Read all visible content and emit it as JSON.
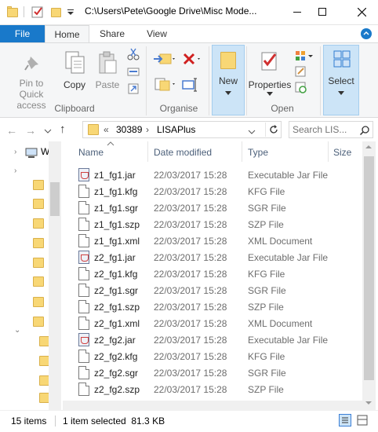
{
  "window": {
    "title": "C:\\Users\\Pete\\Google Drive\\Misc Mode...",
    "controls": [
      "minimize",
      "maximize",
      "close"
    ]
  },
  "ribbon": {
    "tabs": [
      "File",
      "Home",
      "Share",
      "View"
    ],
    "clipboard": {
      "pin": "Pin to Quick access",
      "copy": "Copy",
      "paste": "Paste",
      "label": "Clipboard"
    },
    "organise": {
      "label": "Organise"
    },
    "new": {
      "new_label": "New"
    },
    "open": {
      "properties": "Properties",
      "label": "Open"
    },
    "select": {
      "select_label": "Select"
    }
  },
  "address": {
    "overflow": "«",
    "crumbs": [
      "30389",
      "LISAPlus"
    ],
    "search_placeholder": "Search LIS..."
  },
  "nav": {
    "item_label": "W"
  },
  "columns": [
    "Name",
    "Date modified",
    "Type",
    "Size"
  ],
  "files": [
    {
      "name": "z1_fg1.jar",
      "date": "22/03/2017 15:28",
      "type": "Executable Jar File",
      "icon": "jar"
    },
    {
      "name": "z1_fg1.kfg",
      "date": "22/03/2017 15:28",
      "type": "KFG File",
      "icon": "doc"
    },
    {
      "name": "z1_fg1.sgr",
      "date": "22/03/2017 15:28",
      "type": "SGR File",
      "icon": "doc"
    },
    {
      "name": "z1_fg1.szp",
      "date": "22/03/2017 15:28",
      "type": "SZP File",
      "icon": "doc"
    },
    {
      "name": "z1_fg1.xml",
      "date": "22/03/2017 15:28",
      "type": "XML Document",
      "icon": "doc"
    },
    {
      "name": "z2_fg1.jar",
      "date": "22/03/2017 15:28",
      "type": "Executable Jar File",
      "icon": "jar"
    },
    {
      "name": "z2_fg1.kfg",
      "date": "22/03/2017 15:28",
      "type": "KFG File",
      "icon": "doc"
    },
    {
      "name": "z2_fg1.sgr",
      "date": "22/03/2017 15:28",
      "type": "SGR File",
      "icon": "doc"
    },
    {
      "name": "z2_fg1.szp",
      "date": "22/03/2017 15:28",
      "type": "SZP File",
      "icon": "doc"
    },
    {
      "name": "z2_fg1.xml",
      "date": "22/03/2017 15:28",
      "type": "XML Document",
      "icon": "doc"
    },
    {
      "name": "z2_fg2.jar",
      "date": "22/03/2017 15:28",
      "type": "Executable Jar File",
      "icon": "jar"
    },
    {
      "name": "z2_fg2.kfg",
      "date": "22/03/2017 15:28",
      "type": "KFG File",
      "icon": "doc"
    },
    {
      "name": "z2_fg2.sgr",
      "date": "22/03/2017 15:28",
      "type": "SGR File",
      "icon": "doc"
    },
    {
      "name": "z2_fg2.szp",
      "date": "22/03/2017 15:28",
      "type": "SZP File",
      "icon": "doc"
    }
  ],
  "status": {
    "count": "15 items",
    "selection": "1 item selected  81.3 KB"
  },
  "colors": {
    "file_tab": "#1979ca",
    "column_header": "#4c607a",
    "folder": "#f8d775",
    "close": "#e81123"
  }
}
